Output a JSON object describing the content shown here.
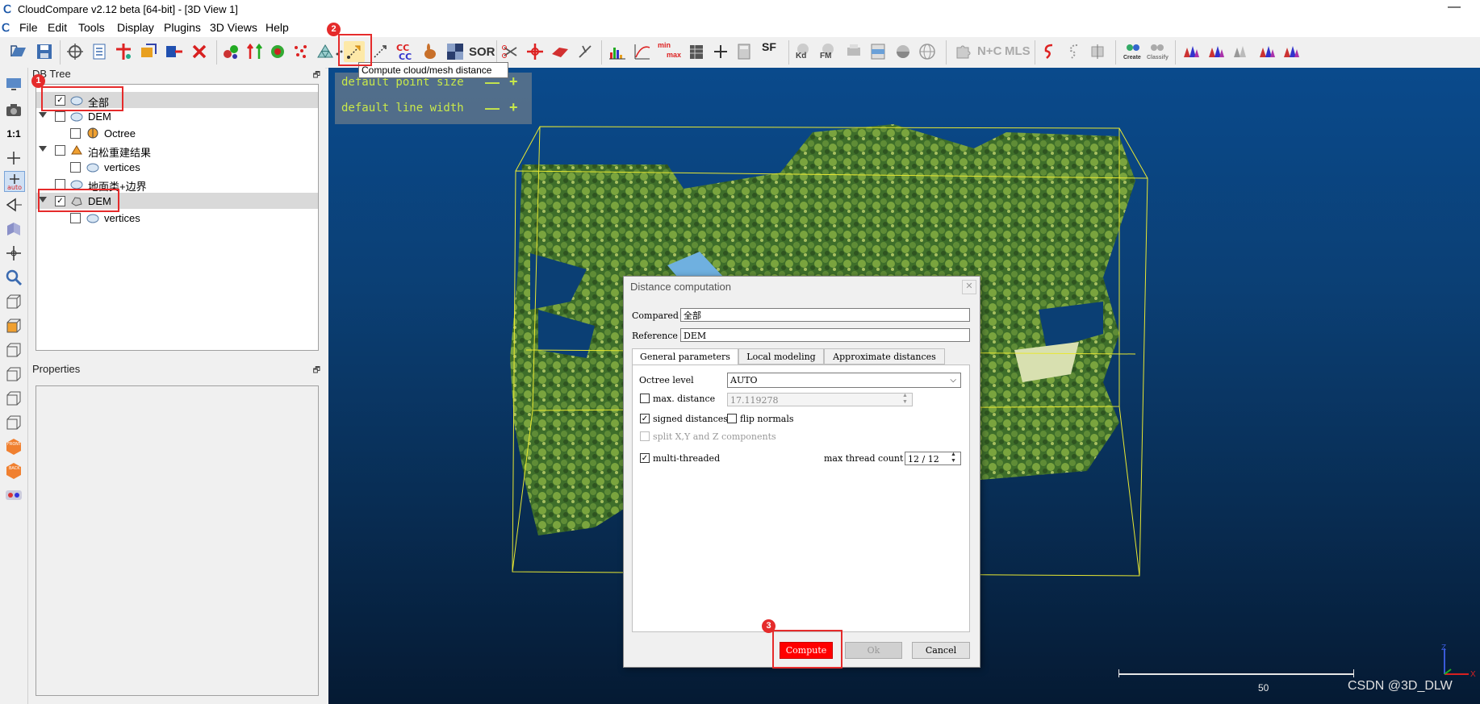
{
  "window": {
    "title": "CloudCompare v2.12 beta [64-bit] - [3D View 1]",
    "app_icon": "cc-logo-icon",
    "minimize_glyph": "—"
  },
  "menu": [
    "File",
    "Edit",
    "Tools",
    "Display",
    "Plugins",
    "3D Views",
    "Help"
  ],
  "toolbar": {
    "text_buttons": {
      "sor": "SOR",
      "sf": "SF",
      "kd": "Kd",
      "fm": "FM",
      "nc": "N+C",
      "mls": "MLS",
      "minmax_top": "min",
      "minmax_bottom": "max",
      "canupo_create": "Create",
      "canupo_classify": "Classify"
    },
    "tooltip": "Compute cloud/mesh distance"
  },
  "db_tree": {
    "title": "DB Tree",
    "float_glyph": "🗗",
    "items": [
      {
        "label": "全部",
        "checked": true,
        "level": 1,
        "icon": "cloud-icon",
        "selected": true,
        "expander": false
      },
      {
        "label": "DEM",
        "checked": false,
        "level": 1,
        "icon": "cloud-icon",
        "selected": false,
        "expander": true
      },
      {
        "label": "Octree",
        "checked": false,
        "level": 2,
        "icon": "octree-icon",
        "selected": false,
        "expander": false
      },
      {
        "label": "泊松重建结果",
        "checked": false,
        "level": 1,
        "icon": "mesh-icon",
        "selected": false,
        "expander": true
      },
      {
        "label": "vertices",
        "checked": false,
        "level": 2,
        "icon": "cloud-icon",
        "selected": false,
        "expander": false
      },
      {
        "label": "地面类+边界",
        "checked": false,
        "level": 1,
        "icon": "cloud-icon",
        "selected": false,
        "expander": false
      },
      {
        "label": "DEM",
        "checked": true,
        "level": 1,
        "icon": "mesh-icon",
        "selected": true,
        "expander": true
      },
      {
        "label": "vertices",
        "checked": false,
        "level": 2,
        "icon": "cloud-icon",
        "selected": false,
        "expander": false
      }
    ]
  },
  "properties": {
    "title": "Properties",
    "float_glyph": "🗗"
  },
  "view_overlay": {
    "point_size_label": "default point size",
    "line_width_label": "default line width",
    "minus": "—",
    "plus": "+"
  },
  "dialog": {
    "title": "Distance computation",
    "close_glyph": "✕",
    "compared_label": "Compared",
    "compared_value": "全部",
    "reference_label": "Reference",
    "reference_value": "DEM",
    "tabs": [
      "General parameters",
      "Local modeling",
      "Approximate distances"
    ],
    "active_tab": 0,
    "octree_level_label": "Octree level",
    "octree_level_value": "AUTO",
    "max_distance_label": "max. distance",
    "max_distance_checked": false,
    "max_distance_value": "17.119278",
    "signed_distances_label": "signed distances",
    "signed_distances_checked": true,
    "flip_normals_label": "flip normals",
    "flip_normals_checked": false,
    "split_label": "split X,Y and Z components",
    "split_checked": false,
    "multithreaded_label": "multi-threaded",
    "multithreaded_checked": true,
    "max_thread_label": "max thread count",
    "max_thread_value": "12 / 12",
    "buttons": {
      "compute": "Compute",
      "ok": "Ok",
      "cancel": "Cancel"
    }
  },
  "annotations": {
    "step1": "1",
    "step2": "2",
    "step3": "3"
  },
  "scale": {
    "value": "50"
  },
  "axes": {
    "x": "X",
    "z": "Z"
  },
  "watermark": "CSDN @3D_DLW",
  "colors": {
    "highlight": "#e52b2b",
    "compute_button": "#ff0000",
    "overlay_text": "#c8e84a",
    "bbox_lines": "#e8e832",
    "view_background_top": "#0a4a8c"
  }
}
